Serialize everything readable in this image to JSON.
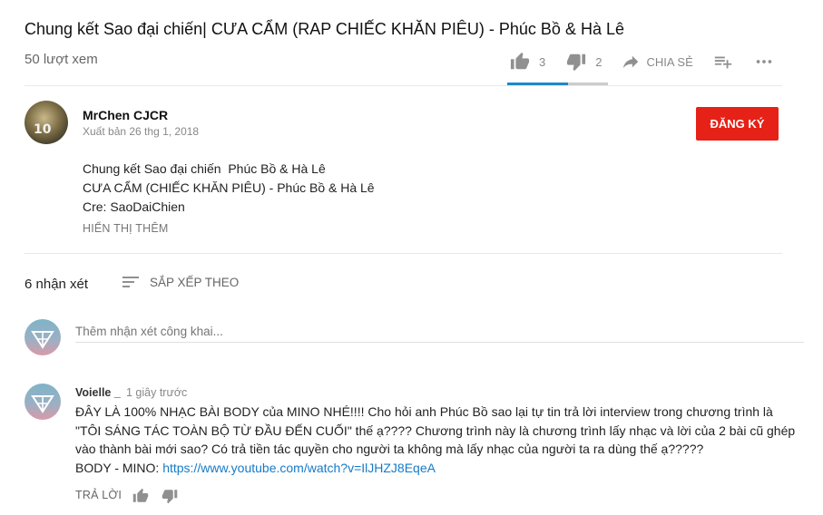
{
  "video": {
    "title": "Chung kết Sao đại chiến| CƯA CẨM (RAP CHIẾC KHĂN PIÊU) - Phúc Bồ & Hà Lê",
    "views": "50 lượt xem",
    "likes": "3",
    "dislikes": "2",
    "share_label": "CHIA SẺ",
    "like_ratio": 0.6
  },
  "channel": {
    "name": "MrChen CJCR",
    "published": "Xuất bản 26 thg 1, 2018",
    "subscribe_label": "ĐĂNG KÝ",
    "avatar_text": "10"
  },
  "description": {
    "lines": [
      "Chung kết Sao đại chiến  Phúc Bồ & Hà Lê",
      "CƯA CẨM (CHIẾC KHĂN PIÊU) - Phúc Bồ & Hà Lê",
      "Cre: SaoDaiChien"
    ],
    "show_more": "HIỂN THỊ THÊM"
  },
  "comments_header": {
    "count": "6 nhận xét",
    "sort_label": "SẮP XẾP THEO"
  },
  "comment_box": {
    "placeholder": "Thêm nhận xét công khai..."
  },
  "comment": {
    "author": "Voielle _",
    "time": "1 giây trước",
    "lines": [
      "ĐÂY LÀ 100% NHẠC BÀI BODY của MINO NHÉ!!!! Cho hỏi anh Phúc Bồ sao lại tự tin trả lời interview trong chương trình là",
      "\"TÔI SÁNG TÁC TOÀN BỘ TỪ ĐẦU ĐẾN CUỐI\" thế ạ???? Chương trình này là chương trình lấy nhạc và lời của 2 bài cũ ghép",
      "vào thành bài mới sao? Có trả tiền tác quyền cho người ta không mà lấy nhạc của người ta ra dùng thế ạ?????"
    ],
    "link_prefix": "BODY - MINO: ",
    "link_text": "https://www.youtube.com/watch?v=IlJHZJ8EqeA",
    "reply_label": "TRẢ LỜI"
  },
  "colors": {
    "subscribe": "#e62117",
    "like_bar": "#1e88c9",
    "link": "#167ac6"
  },
  "icons": [
    "thumbs-up-icon",
    "thumbs-down-icon",
    "share-icon",
    "add-to-playlist-icon",
    "more-icon",
    "sort-icon"
  ]
}
